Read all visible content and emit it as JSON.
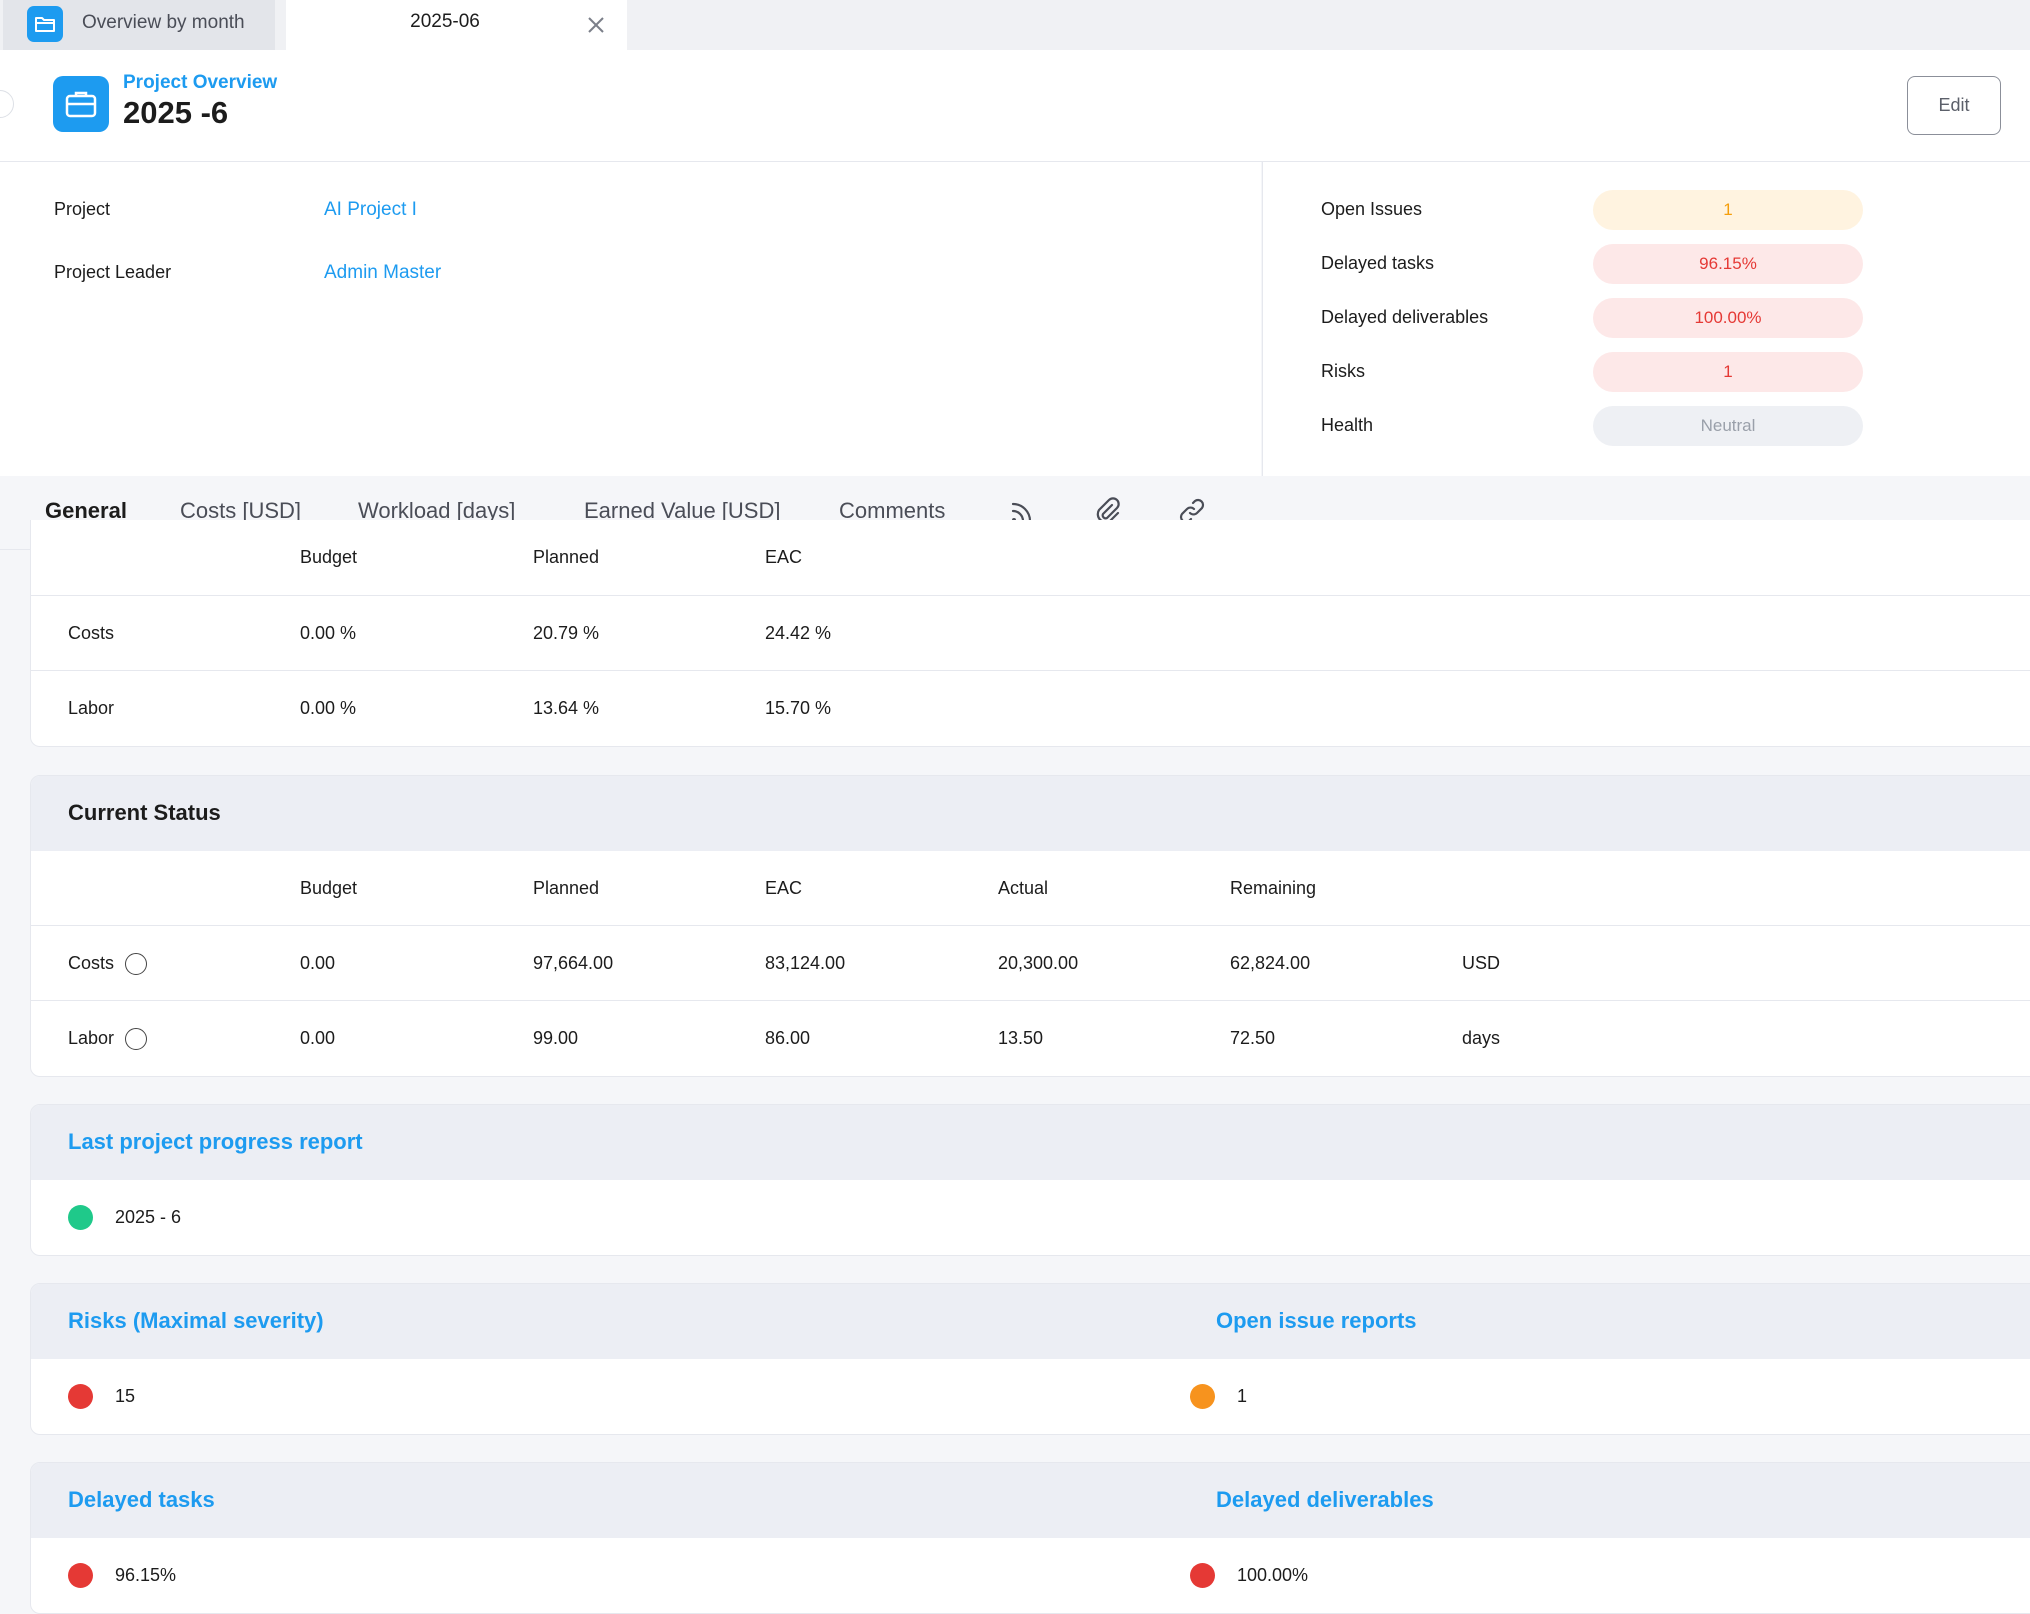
{
  "tabs": {
    "overview_label": "Overview by month",
    "active_label": "2025-06"
  },
  "header": {
    "subtitle": "Project Overview",
    "title": "2025 -6",
    "edit_label": "Edit"
  },
  "info": {
    "project_label": "Project",
    "project_value": "AI Project I",
    "leader_label": "Project Leader",
    "leader_value": "Admin Master"
  },
  "kpis": [
    {
      "label": "Open Issues",
      "value": "1",
      "color": "orange"
    },
    {
      "label": "Delayed tasks",
      "value": "96.15%",
      "color": "red"
    },
    {
      "label": "Delayed deliverables",
      "value": "100.00%",
      "color": "red"
    },
    {
      "label": "Risks",
      "value": "1",
      "color": "red"
    },
    {
      "label": "Health",
      "value": "Neutral",
      "color": "grey"
    }
  ],
  "nav": {
    "general": "General",
    "costs": "Costs [USD]",
    "workload": "Workload [days]",
    "earned": "Earned Value [USD]",
    "comments": "Comments"
  },
  "percent_table": {
    "headers": {
      "budget": "Budget",
      "planned": "Planned",
      "eac": "EAC"
    },
    "rows": [
      {
        "label": "Costs",
        "budget": "0.00 %",
        "planned": "20.79 %",
        "eac": "24.42 %"
      },
      {
        "label": "Labor",
        "budget": "0.00 %",
        "planned": "13.64 %",
        "eac": "15.70 %"
      }
    ]
  },
  "current_status": {
    "title": "Current Status",
    "headers": {
      "budget": "Budget",
      "planned": "Planned",
      "eac": "EAC",
      "actual": "Actual",
      "remaining": "Remaining"
    },
    "rows": [
      {
        "label": "Costs",
        "budget": "0.00",
        "planned": "97,664.00",
        "eac": "83,124.00",
        "actual": "20,300.00",
        "remaining": "62,824.00",
        "unit": "USD"
      },
      {
        "label": "Labor",
        "budget": "0.00",
        "planned": "99.00",
        "eac": "86.00",
        "actual": "13.50",
        "remaining": "72.50",
        "unit": "days"
      }
    ]
  },
  "progress_report": {
    "title": "Last project progress report",
    "value": "2025 - 6",
    "dot_color": "#1fc98a"
  },
  "risks": {
    "title": "Risks (Maximal severity)",
    "value": "15",
    "dot_color": "#e53935"
  },
  "issues": {
    "title": "Open issue reports",
    "value": "1",
    "dot_color": "#f7931e"
  },
  "delayed_tasks": {
    "title": "Delayed tasks",
    "value": "96.15%",
    "dot_color": "#e53935"
  },
  "delayed_deliverables": {
    "title": "Delayed deliverables",
    "value": "100.00%",
    "dot_color": "#e53935"
  },
  "colors": {
    "accent": "#1d9bf0"
  }
}
